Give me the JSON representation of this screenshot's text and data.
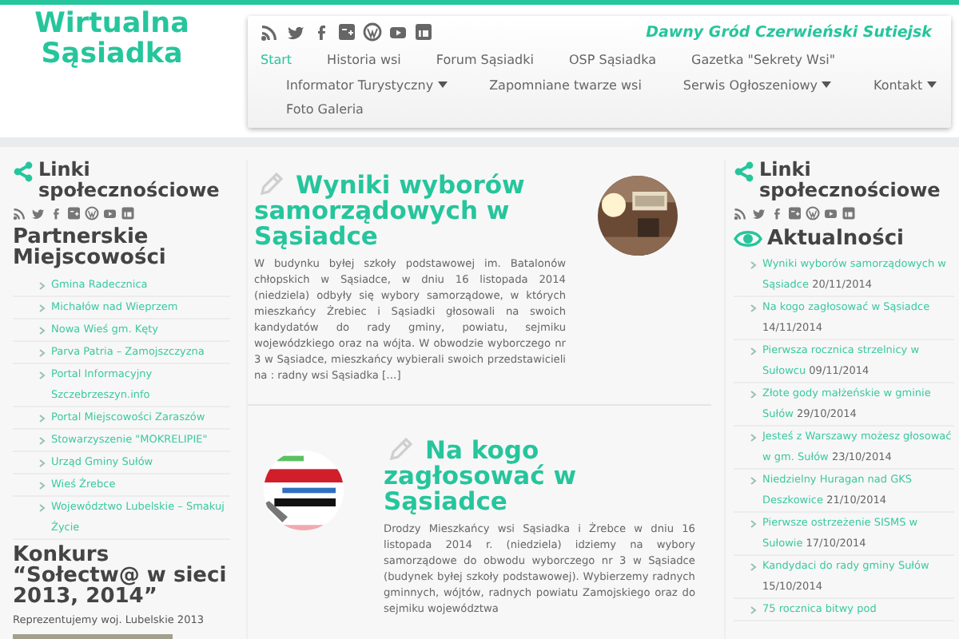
{
  "site": {
    "title_line_1": "Wirtualna",
    "title_line_2": "Sąsiadka",
    "tagline": "Dawny Gród Czerwieński Sutiejsk"
  },
  "nav": [
    {
      "label": "Start",
      "selected": true,
      "has_dropdown": false
    },
    {
      "label": "Historia wsi",
      "selected": false,
      "has_dropdown": false
    },
    {
      "label": "Forum Sąsiadki",
      "selected": false,
      "has_dropdown": false
    },
    {
      "label": "OSP Sąsiadka",
      "selected": false,
      "has_dropdown": false
    },
    {
      "label": "Gazetka \"Sekrety Wsi\"",
      "selected": false,
      "has_dropdown": false
    },
    {
      "label": "Informator Turystyczny",
      "selected": false,
      "has_dropdown": true
    },
    {
      "label": "Zapomniane twarze wsi",
      "selected": false,
      "has_dropdown": false
    },
    {
      "label": "Serwis Ogłoszeniowy",
      "selected": false,
      "has_dropdown": true
    },
    {
      "label": "Kontakt",
      "selected": false,
      "has_dropdown": true
    },
    {
      "label": "Foto Galeria",
      "selected": false,
      "has_dropdown": false
    }
  ],
  "left_sidebar": {
    "social_heading": "Linki społecznościowe",
    "partners_heading": "Partnerskie Miejscowości",
    "partners": [
      "Gmina Radecznica",
      "Michałów nad Wieprzem",
      "Nowa Wieś gm. Kęty",
      "Parva Patria – Zamojszczyzna",
      "Portal Informacyjny Szczebrzeszyn.info",
      "Portal Miejscowości Zaraszów",
      "Stowarzyszenie \"MOKRELIPIE\"",
      "Urząd Gminy Sułów",
      "Wieś Żrebce",
      "Województwo Lubelskie – Smakuj Życie"
    ],
    "contest_heading": "Konkurs “Sołectw@ w sieci 2013, 2014”",
    "contest_text": "Reprezentujemy woj. Lubelskie 2013"
  },
  "articles": [
    {
      "title": "Wyniki wyborów samorządowych w Sąsiadce",
      "excerpt": "W budynku byłej szkoły podstawowej im. Batalonów chłopskich w Sąsiadce, w dniu 16 listopada 2014 (niedziela) odbyły się wybory samorządowe, w których mieszkańcy Żrebiec i Sąsiadki  głosowali na swoich kandydatów do rady gminy, powiatu, sejmiku wojewódzkiego oraz na wójta. W obwodzie wyborczego nr 3 w Sąsiadce, mieszkańcy wybierali swoich przedstawicieli na : radny wsi Sąsiadka […]"
    },
    {
      "title": "Na kogo zagłosować w Sąsiadce",
      "excerpt": "Drodzy Mieszkańcy wsi Sąsiadka i Żrebce w dniu 16 listopada 2014 r. (niedziela) idziemy na wybory samorządowe do obwodu wyborczego nr 3 w Sąsiadce (budynek byłej szkoły podstawowej). Wybierzemy radnych gminnych, wójtów, radnych powiatu Zamojskiego oraz do sejmiku województwa"
    }
  ],
  "right_sidebar": {
    "social_heading": "Linki społecznościowe",
    "news_heading": "Aktualności",
    "news": [
      {
        "title": "Wyniki wyborów samorządowych w Sąsiadce",
        "date": "20/11/2014"
      },
      {
        "title": "Na kogo zagłosować w Sąsiadce",
        "date": "14/11/2014"
      },
      {
        "title": "Pierwsza rocznica strzelnicy w Sułowcu",
        "date": "09/11/2014"
      },
      {
        "title": "Złote gody małżeńskie w gminie Sułów",
        "date": "29/10/2014"
      },
      {
        "title": "Jesteś z Warszawy możesz głosować w gm. Sułów",
        "date": "23/10/2014"
      },
      {
        "title": "Niedzielny Huragan nad GKS Deszkowice",
        "date": "21/10/2014"
      },
      {
        "title": "Pierwsze ostrzeżenie SISMS w Sułowie",
        "date": "17/10/2014"
      },
      {
        "title": "Kandydaci do rady gminy Sułów",
        "date": "15/10/2014"
      },
      {
        "title": "75 rocznica bitwy pod"
      }
    ]
  }
}
